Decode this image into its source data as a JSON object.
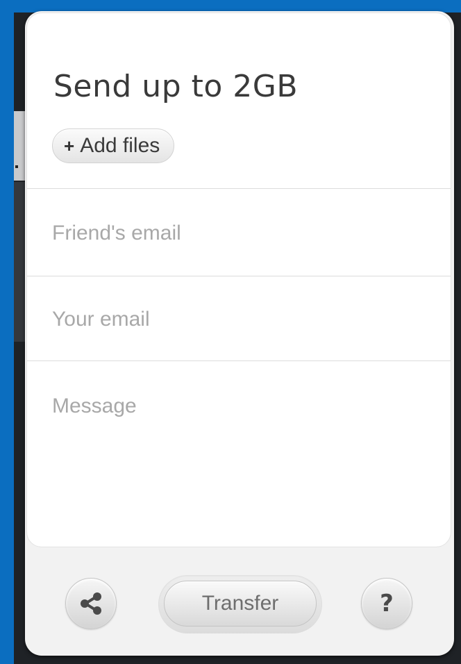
{
  "card": {
    "title": "Send up to 2GB",
    "add_files": {
      "icon": "plus-icon",
      "plus": "+",
      "label": "Add files"
    },
    "fields": {
      "friend_email": {
        "value": "",
        "placeholder": "Friend's email"
      },
      "your_email": {
        "value": "",
        "placeholder": "Your email"
      },
      "message": {
        "value": "",
        "placeholder": "Message"
      }
    }
  },
  "footer": {
    "share": {
      "icon": "share-icon"
    },
    "transfer_label": "Transfer",
    "help": {
      "icon": "question-icon",
      "glyph": "?"
    }
  },
  "colors": {
    "page_blue": "#0b6ec0",
    "card_bg": "#ffffff",
    "title_text": "#3a3a3a",
    "placeholder_text": "#a8a8a8"
  }
}
